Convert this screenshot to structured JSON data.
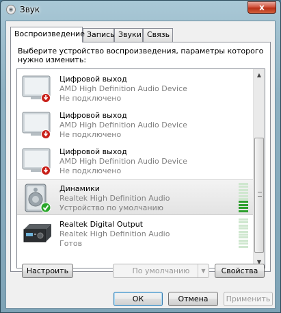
{
  "window": {
    "title": "Звук",
    "close_label": "x"
  },
  "tabs": [
    {
      "label": "Воспроизведение",
      "active": true
    },
    {
      "label": "Запись",
      "active": false
    },
    {
      "label": "Звуки",
      "active": false
    },
    {
      "label": "Связь",
      "active": false
    }
  ],
  "instruction": "Выберите устройство воспроизведения, параметры которого нужно изменить:",
  "devices": [
    {
      "name": "Цифровой выход",
      "description": "AMD High Definition Audio Device",
      "status": "Не подключено",
      "icon": "monitor-icon",
      "badge": "disconnected"
    },
    {
      "name": "Цифровой выход",
      "description": "AMD High Definition Audio Device",
      "status": "Не подключено",
      "icon": "monitor-icon",
      "badge": "disconnected"
    },
    {
      "name": "Цифровой выход",
      "description": "AMD High Definition Audio Device",
      "status": "Не подключено",
      "icon": "monitor-icon",
      "badge": "disconnected"
    },
    {
      "name": "Динамики",
      "description": "Realtek High Definition Audio",
      "status": "Устройство по умолчанию",
      "icon": "speaker-icon",
      "badge": "default",
      "level": 0.4
    },
    {
      "name": "Realtek Digital Output",
      "description": "Realtek High Definition Audio",
      "status": "Готов",
      "icon": "receiver-icon",
      "badge": "none",
      "level": 0
    }
  ],
  "buttons": {
    "configure": "Настроить",
    "set_default": "По умолчанию",
    "properties": "Свойства",
    "ok": "ОК",
    "cancel": "Отмена",
    "apply": "Применить"
  },
  "colors": {
    "meter_on": "#2ea02e",
    "meter_off": "#cfe7cf",
    "badge_red": "#c8201a",
    "badge_green": "#2aa62a"
  }
}
